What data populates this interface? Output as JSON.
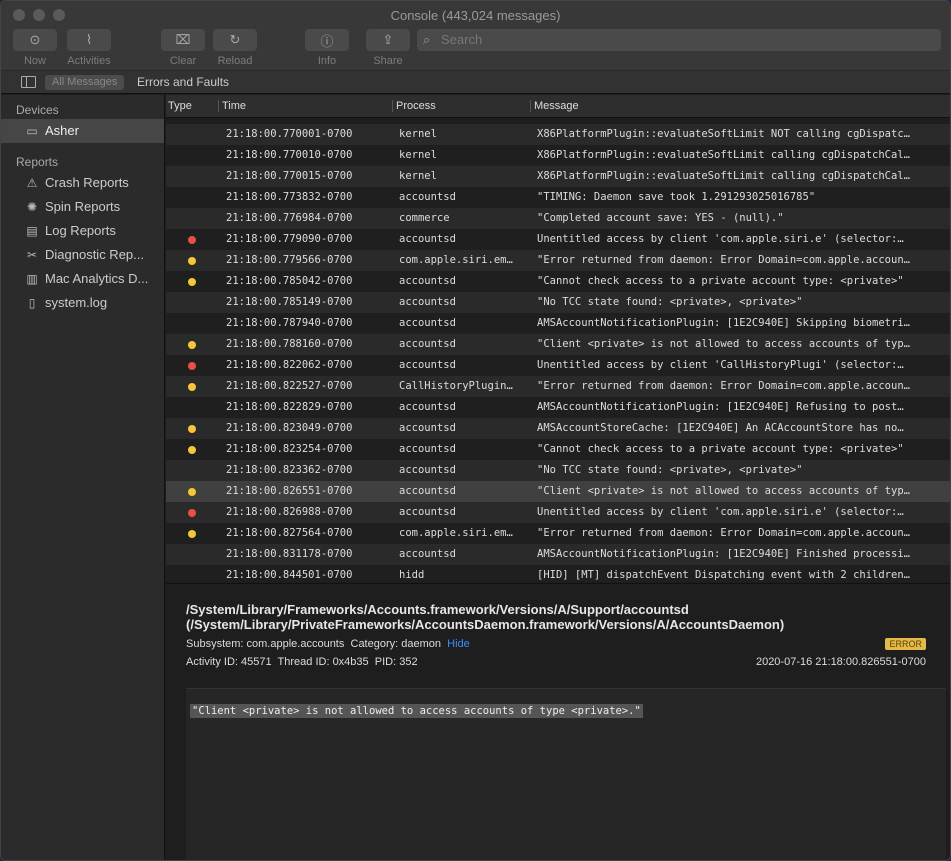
{
  "window": {
    "title": "Console (443,024 messages)"
  },
  "toolbar": {
    "now": "Now",
    "activities": "Activities",
    "clear": "Clear",
    "reload": "Reload",
    "info": "Info",
    "share": "Share",
    "search_placeholder": "Search"
  },
  "filter": {
    "all": "All Messages",
    "errors": "Errors and Faults"
  },
  "sidebar": {
    "devices_header": "Devices",
    "device": "Asher",
    "reports_header": "Reports",
    "reports": [
      {
        "label": "Crash Reports",
        "icon": "crash-report-icon"
      },
      {
        "label": "Spin Reports",
        "icon": "spin-report-icon"
      },
      {
        "label": "Log Reports",
        "icon": "log-report-icon"
      },
      {
        "label": "Diagnostic Rep...",
        "icon": "diagnostic-icon"
      },
      {
        "label": "Mac Analytics D...",
        "icon": "analytics-icon"
      },
      {
        "label": "system.log",
        "icon": "file-icon"
      }
    ]
  },
  "columns": {
    "type": "Type",
    "time": "Time",
    "process": "Process",
    "message": "Message"
  },
  "colors": {
    "error": "#ec4e47",
    "fault": "#f5c63a"
  },
  "rows": [
    {
      "type": "",
      "time": "21:18:00.770001-0700",
      "process": "kernel",
      "message": "X86PlatformPlugin::evaluateSoftLimit NOT calling cgDispatc…"
    },
    {
      "type": "",
      "time": "21:18:00.770010-0700",
      "process": "kernel",
      "message": "X86PlatformPlugin::evaluateSoftLimit calling cgDispatchCal…"
    },
    {
      "type": "",
      "time": "21:18:00.770015-0700",
      "process": "kernel",
      "message": "X86PlatformPlugin::evaluateSoftLimit calling cgDispatchCal…"
    },
    {
      "type": "",
      "time": "21:18:00.773832-0700",
      "process": "accountsd",
      "message": "\"TIMING: Daemon save took 1.291293025016785\""
    },
    {
      "type": "",
      "time": "21:18:00.776984-0700",
      "process": "commerce",
      "message": "\"Completed account save: YES - (null).\""
    },
    {
      "type": "error",
      "time": "21:18:00.779090-0700",
      "process": "accountsd",
      "message": "Unentitled access by client 'com.apple.siri.e' (selector:…"
    },
    {
      "type": "fault",
      "time": "21:18:00.779566-0700",
      "process": "com.apple.siri.em…",
      "message": "\"Error returned from daemon: Error Domain=com.apple.accoun…"
    },
    {
      "type": "fault",
      "time": "21:18:00.785042-0700",
      "process": "accountsd",
      "message": "\"Cannot check access to a private account type: <private>\""
    },
    {
      "type": "",
      "time": "21:18:00.785149-0700",
      "process": "accountsd",
      "message": "\"No TCC state found: <private>, <private>\""
    },
    {
      "type": "",
      "time": "21:18:00.787940-0700",
      "process": "accountsd",
      "message": "AMSAccountNotificationPlugin: [1E2C940E] Skipping biometri…"
    },
    {
      "type": "fault",
      "time": "21:18:00.788160-0700",
      "process": "accountsd",
      "message": "\"Client <private> is not allowed to access accounts of typ…"
    },
    {
      "type": "error",
      "time": "21:18:00.822062-0700",
      "process": "accountsd",
      "message": "Unentitled access by client 'CallHistoryPlugi' (selector:…"
    },
    {
      "type": "fault",
      "time": "21:18:00.822527-0700",
      "process": "CallHistoryPlugin…",
      "message": "\"Error returned from daemon: Error Domain=com.apple.accoun…"
    },
    {
      "type": "",
      "time": "21:18:00.822829-0700",
      "process": "accountsd",
      "message": "AMSAccountNotificationPlugin: [1E2C940E] Refusing to post…"
    },
    {
      "type": "fault",
      "time": "21:18:00.823049-0700",
      "process": "accountsd",
      "message": "AMSAccountStoreCache: [1E2C940E] An ACAccountStore has no…"
    },
    {
      "type": "fault",
      "time": "21:18:00.823254-0700",
      "process": "accountsd",
      "message": "\"Cannot check access to a private account type: <private>\""
    },
    {
      "type": "",
      "time": "21:18:00.823362-0700",
      "process": "accountsd",
      "message": "\"No TCC state found: <private>, <private>\""
    },
    {
      "type": "fault",
      "time": "21:18:00.826551-0700",
      "process": "accountsd",
      "message": "\"Client <private> is not allowed to access accounts of typ…",
      "selected": true
    },
    {
      "type": "error",
      "time": "21:18:00.826988-0700",
      "process": "accountsd",
      "message": "Unentitled access by client 'com.apple.siri.e' (selector:…"
    },
    {
      "type": "fault",
      "time": "21:18:00.827564-0700",
      "process": "com.apple.siri.em…",
      "message": "\"Error returned from daemon: Error Domain=com.apple.accoun…"
    },
    {
      "type": "",
      "time": "21:18:00.831178-0700",
      "process": "accountsd",
      "message": "AMSAccountNotificationPlugin: [1E2C940E] Finished processi…"
    },
    {
      "type": "",
      "time": "21:18:00.844501-0700",
      "process": "hidd",
      "message": "[HID] [MT] dispatchEvent Dispatching event with 2 children…"
    }
  ],
  "detail": {
    "path": "/System/Library/Frameworks/Accounts.framework/Versions/A/Support/accountsd (/System/Library/PrivateFrameworks/AccountsDaemon.framework/Versions/A/AccountsDaemon)",
    "subsystem_label": "Subsystem:",
    "subsystem": "com.apple.accounts",
    "category_label": "Category:",
    "category": "daemon",
    "hide": "Hide",
    "badge": "ERROR",
    "activity_label": "Activity ID:",
    "activity": "45571",
    "thread_label": "Thread ID:",
    "thread": "0x4b35",
    "pid_label": "PID:",
    "pid": "352",
    "timestamp": "2020-07-16 21:18:00.826551-0700",
    "message": "\"Client <private> is not allowed to access accounts of type <private>.\""
  }
}
